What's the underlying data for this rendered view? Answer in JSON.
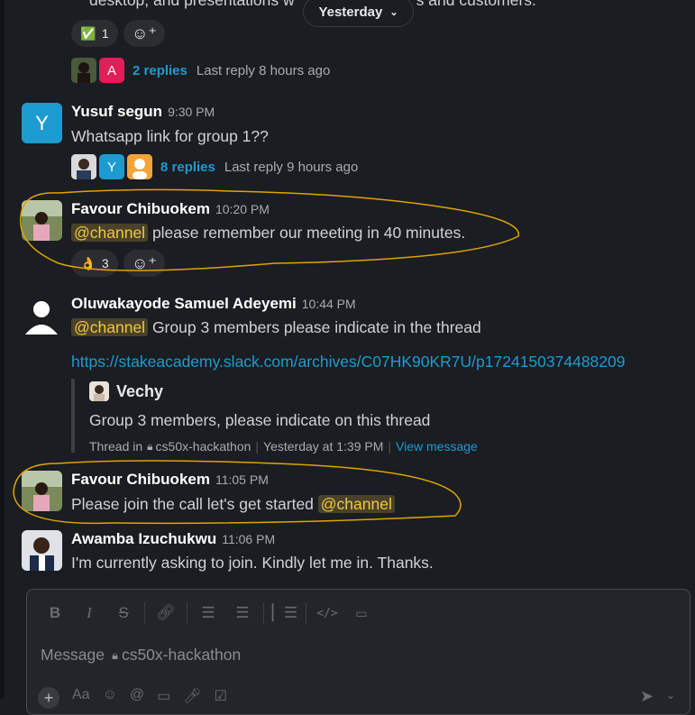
{
  "date_divider": {
    "label": "Yesterday"
  },
  "top_message": {
    "partial_text": "desktop, and presentations w",
    "partial_text_end": "s and customers.",
    "reactions": [
      {
        "emoji": "✅",
        "count": "1"
      }
    ],
    "thread": {
      "replies": "2 replies",
      "last_reply": "Last reply 8 hours ago",
      "avatar_letters": [
        "A"
      ]
    }
  },
  "messages": [
    {
      "author": "Yusuf segun",
      "time": "9:30 PM",
      "avatar_letter": "Y",
      "text": "Whatsapp link for group 1??",
      "thread": {
        "replies": "8 replies",
        "last_reply": "Last reply 9 hours ago",
        "avatar_letters": [
          "Y"
        ]
      }
    },
    {
      "author": "Favour Chibuokem",
      "time": "10:20 PM",
      "mention": "@channel",
      "text": " please remember our meeting in 40 minutes.",
      "reactions": [
        {
          "emoji": "👌",
          "count": "3"
        }
      ]
    },
    {
      "author": "Oluwakayode Samuel Adeyemi",
      "time": "10:44 PM",
      "mention": "@channel",
      "text": " Group 3 members please indicate in the thread",
      "link": "https://stakeacademy.slack.com/archives/C07HK90KR7U/p1724150374488209",
      "quote": {
        "author": "Vechy",
        "text": "Group 3 members, please indicate on this thread",
        "thread_in": "Thread in",
        "channel": "cs50x-hackathon",
        "timestamp": "Yesterday at 1:39 PM",
        "view": "View message"
      }
    },
    {
      "author": "Favour Chibuokem",
      "time": "11:05 PM",
      "text": "Please join the call let's get started ",
      "mention": "@channel"
    },
    {
      "author": "Awamba Izuchukwu",
      "time": "11:06 PM",
      "text": "I'm currently asking to join. Kindly let me in. Thanks."
    }
  ],
  "composer": {
    "placeholder_prefix": "Message",
    "channel": "cs50x-hackathon",
    "toolbar": [
      "B",
      "I",
      "S"
    ],
    "bottom_text": "Aa"
  },
  "colors": {
    "mention": "#f2c744",
    "link": "#1d9bd1",
    "annotation": "#e0a400",
    "background": "#1a1d21"
  }
}
